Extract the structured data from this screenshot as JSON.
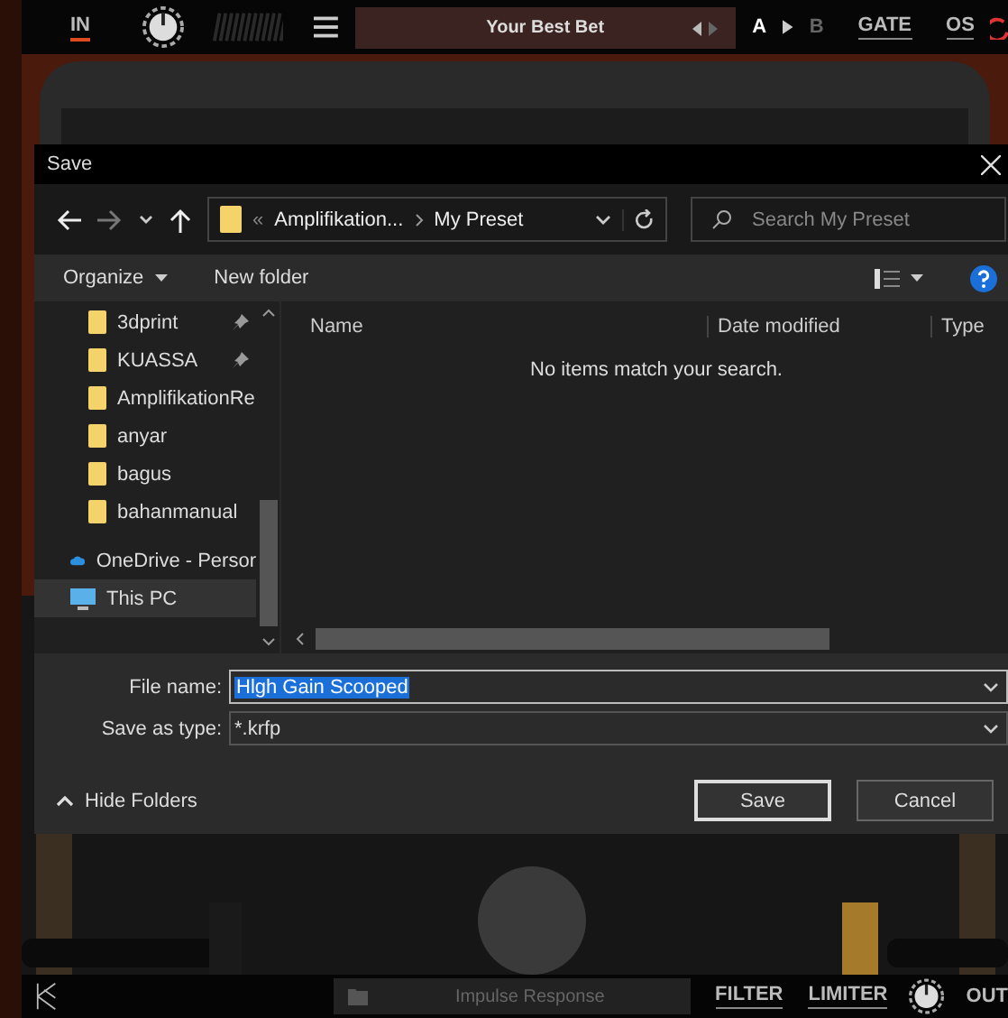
{
  "top_bar": {
    "input_label": "IN",
    "input_on": true,
    "preset": "Your Best Bet",
    "ab": [
      {
        "label": "A",
        "selected": true
      },
      {
        "label": "B",
        "selected": false
      }
    ],
    "toggles": [
      "GATE",
      "OS"
    ]
  },
  "dialog": {
    "title": "Save",
    "address": {
      "overflow": "«",
      "path": [
        "Amplifikation...",
        "My Preset"
      ]
    },
    "search_placeholder": "Search My Preset",
    "toolbar": [
      "Organize",
      "New folder"
    ],
    "nav_items": [
      {
        "kind": "folder",
        "label": "3dprint",
        "pinned": true,
        "selected": false
      },
      {
        "kind": "folder",
        "label": "KUASSA",
        "pinned": true,
        "selected": false
      },
      {
        "kind": "folder",
        "label": "AmplifikationRe",
        "pinned": false,
        "selected": false
      },
      {
        "kind": "folder",
        "label": "anyar",
        "pinned": false,
        "selected": false
      },
      {
        "kind": "folder",
        "label": "bagus",
        "pinned": false,
        "selected": false
      },
      {
        "kind": "folder",
        "label": "bahanmanual",
        "pinned": false,
        "selected": false
      },
      {
        "kind": "cloud",
        "label": "OneDrive - Persor",
        "pinned": false,
        "selected": false
      },
      {
        "kind": "pc",
        "label": "This PC",
        "pinned": false,
        "selected": true
      }
    ],
    "columns": [
      "Name",
      "Date modified",
      "Type"
    ],
    "empty_message": "No items match your search.",
    "file_name_label": "File name:",
    "file_name": "Hlgh Gain Scooped",
    "type_label": "Save as type:",
    "type_value": "*.krfp",
    "hide_folders": "Hide Folders",
    "buttons": [
      {
        "label": "Save",
        "default": true
      },
      {
        "label": "Cancel",
        "default": false
      }
    ]
  },
  "bottom_bar": {
    "ir_placeholder": "Impulse Response",
    "toggles": [
      "FILTER",
      "LIMITER"
    ],
    "output_label": "OUT"
  }
}
